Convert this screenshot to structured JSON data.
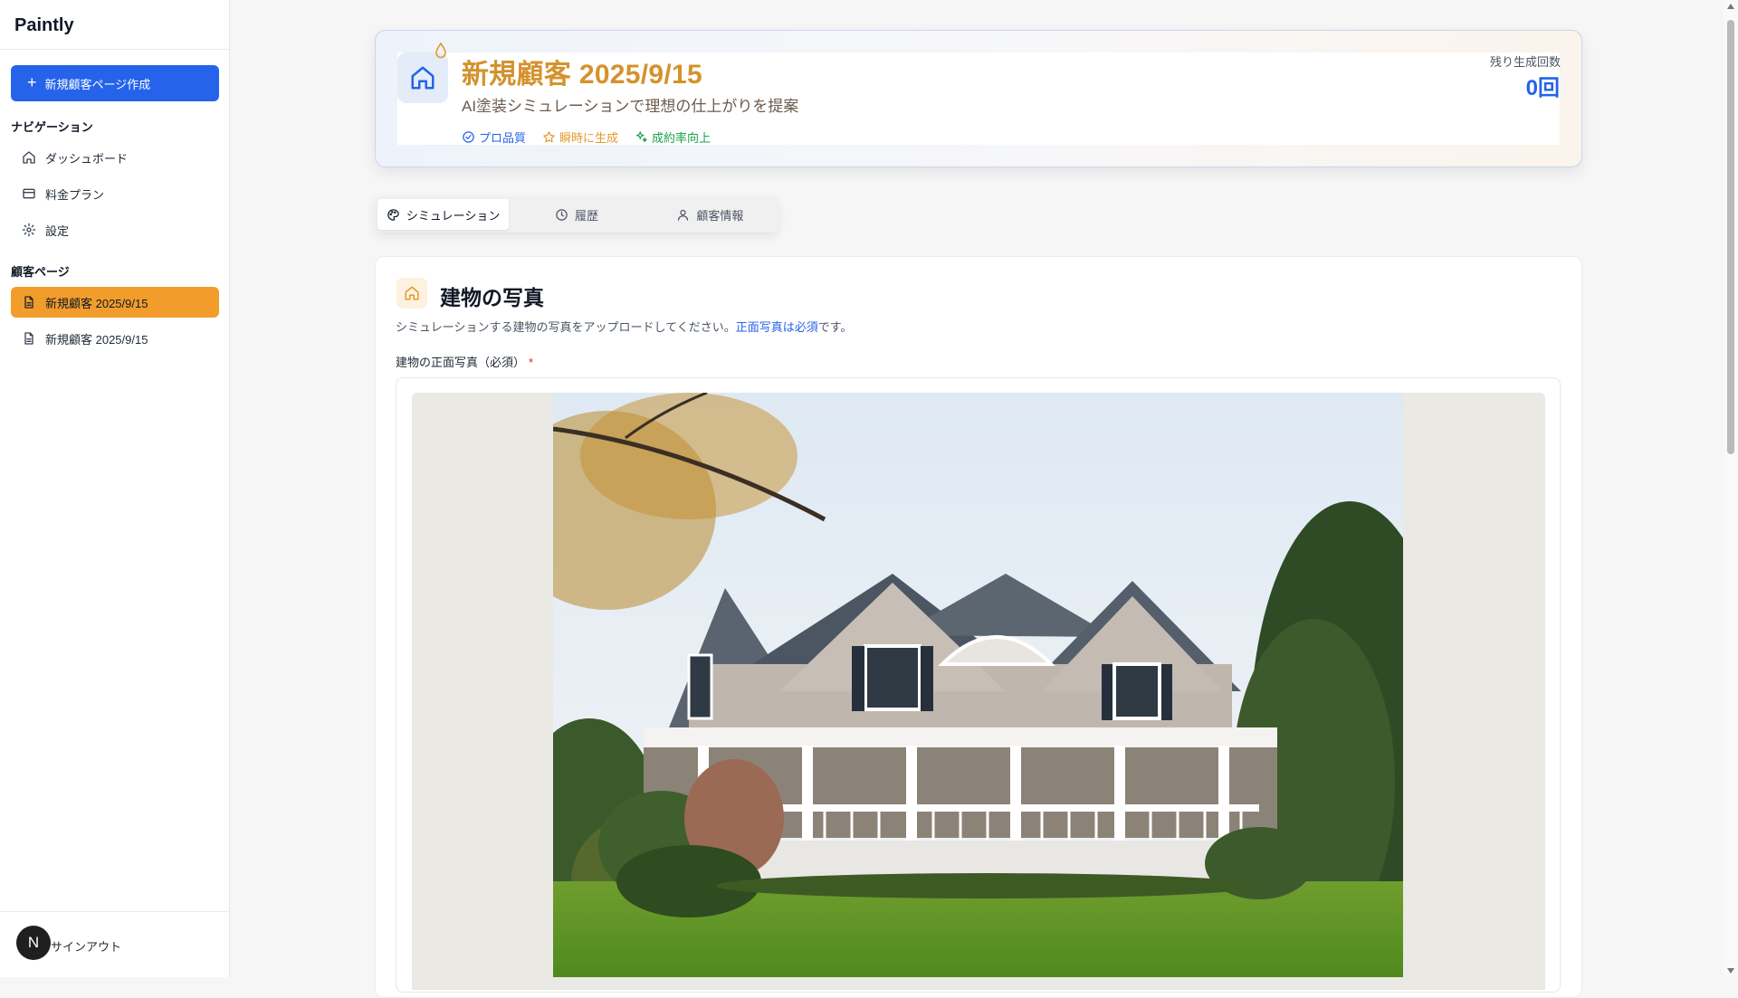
{
  "app": {
    "name": "Paintly"
  },
  "sidebar": {
    "new_button": "新規顧客ページ作成",
    "nav_heading": "ナビゲーション",
    "nav": [
      {
        "label": "ダッシュボード",
        "icon": "home-icon"
      },
      {
        "label": "料金プラン",
        "icon": "credit-card-icon"
      },
      {
        "label": "設定",
        "icon": "gear-icon"
      }
    ],
    "customers_heading": "顧客ページ",
    "customers": [
      {
        "label": "新規顧客 2025/9/15",
        "active": true
      },
      {
        "label": "新規顧客 2025/9/15",
        "active": false
      }
    ],
    "user_initial": "N",
    "signout": "サインアウト"
  },
  "header": {
    "title": "新規顧客 2025/9/15",
    "subtitle": "AI塗装シミュレーションで理想の仕上がりを提案",
    "tags": [
      {
        "label": "プロ品質",
        "color": "#2563eb",
        "icon": "check-circle-icon"
      },
      {
        "label": "瞬時に生成",
        "color": "#e39a2c",
        "icon": "star-icon"
      },
      {
        "label": "成約率向上",
        "color": "#16a34a",
        "icon": "sparkle-icon"
      }
    ],
    "remaining_label": "残り生成回数",
    "remaining_count": "0回"
  },
  "tabs": [
    {
      "label": "シミュレーション",
      "icon": "palette-icon",
      "active": true
    },
    {
      "label": "履歴",
      "icon": "clock-icon",
      "active": false
    },
    {
      "label": "顧客情報",
      "icon": "user-icon",
      "active": false
    }
  ],
  "section": {
    "title": "建物の写真",
    "desc_before": "シミュレーションする建物の写真をアップロードしてください。",
    "desc_link": "正面写真は必須",
    "desc_after": "です。",
    "field_label": "建物の正面写真（必須）",
    "required_mark": "*"
  },
  "colors": {
    "primary": "#2563eb",
    "accent": "#f29d2b",
    "title_gold": "#d4922d"
  }
}
